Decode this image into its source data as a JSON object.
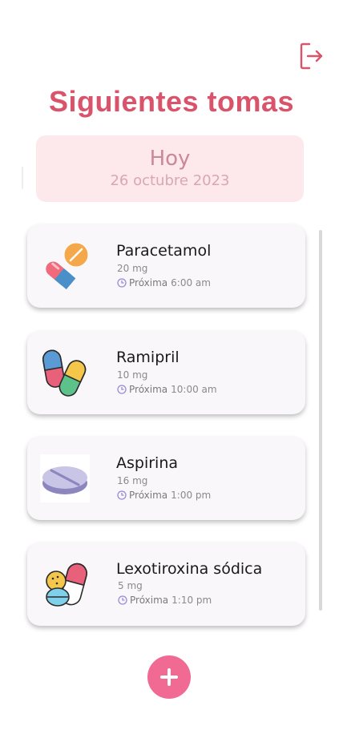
{
  "header": {
    "title": "Siguientes tomas"
  },
  "date": {
    "day_label": "Hoy",
    "full_date": "26 octubre 2023"
  },
  "next_label": "Próxima",
  "medications": [
    {
      "name": "Paracetamol",
      "dose": "20 mg",
      "time": "6:00 am",
      "icon": "capsule-and-tablet-icon"
    },
    {
      "name": "Ramipril",
      "dose": "10 mg",
      "time": "10:00 am",
      "icon": "two-capsules-icon"
    },
    {
      "name": "Aspirina",
      "dose": "16 mg",
      "time": "1:00 pm",
      "icon": "round-tablet-icon"
    },
    {
      "name": "Lexotiroxina sódica",
      "dose": "5 mg",
      "time": "1:10 pm",
      "icon": "mixed-pills-icon"
    }
  ],
  "colors": {
    "accent": "#d9536b",
    "date_bg": "#fde8ec",
    "add_button": "#f06a94"
  }
}
